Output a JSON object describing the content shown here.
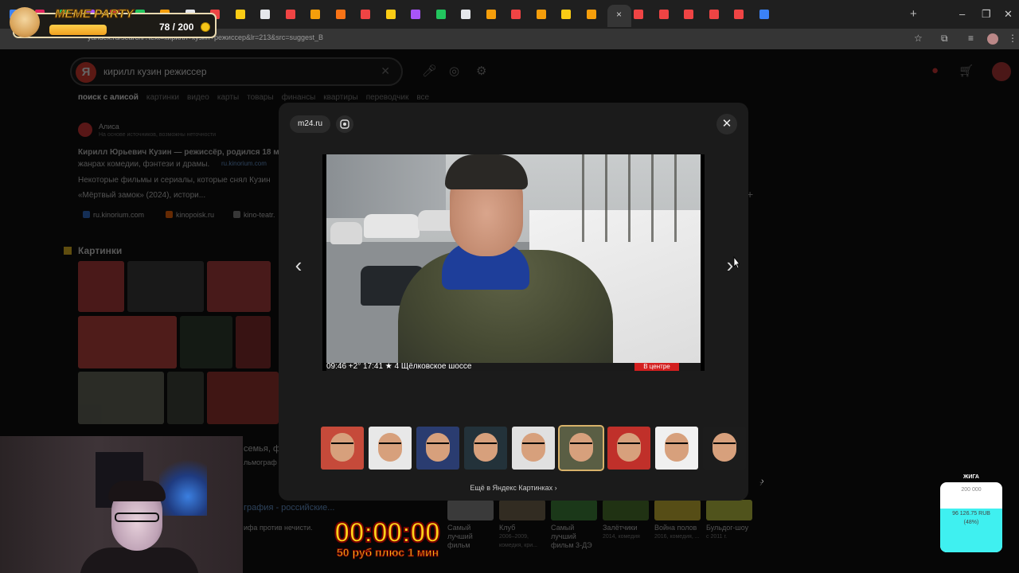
{
  "browser": {
    "active_tab_close": "×",
    "new_tab": "+",
    "window_controls": {
      "minimize": "–",
      "maximize": "❐",
      "close": "✕"
    },
    "url": "yandex.ru/search/?text=кирилл+кузин+режиссер&lr=213&src=suggest_B",
    "tab_favicon_colors": [
      "#3b82f6",
      "#e0245e",
      "#22c55e",
      "#a855f7",
      "#ef4444",
      "#22c55e",
      "#f59e0b",
      "#e5e7eb",
      "#ef4444",
      "#facc15",
      "#e5e7eb",
      "#ef4444",
      "#f59e0b",
      "#f97316",
      "#ef4444",
      "#facc15",
      "#a855f7",
      "#22c55e",
      "#e5e7eb",
      "#f59e0b",
      "#ef4444",
      "#f59e0b",
      "#facc15",
      "#f59e0b",
      "#ef4444",
      "#ef4444",
      "#ef4444",
      "#ef4444",
      "#ef4444",
      "#3b82f6"
    ]
  },
  "overlay_meme": {
    "title": "MEME PARTY",
    "count": "78 / 200"
  },
  "yandex": {
    "query": "кирилл кузин режиссер",
    "nav_tabs": [
      "поиск с алисой",
      "картинки",
      "видео",
      "карты",
      "товары",
      "финансы",
      "квартиры",
      "переводчик",
      "все"
    ],
    "alice_name": "Алиса",
    "alice_sub": "На основе источников, возможны неточности",
    "answer_line1": "Кирилл Юрьевич Кузин — режиссёр, родился 18 м",
    "answer_line2": "жанрах комедии, фэнтези и драмы.",
    "answer_source": "ru.kinorium.com",
    "answer_line3": "Некоторые фильмы и сериалы, которые снял Кузин",
    "answer_line4": "«Мёртвый замок» (2024), истори...",
    "sources": [
      "ru.kinorium.com",
      "kinopoisk.ru",
      "kino-teatr."
    ],
    "images_section": "Картинки",
    "bg_snippet_1": "семья, фи",
    "bg_snippet_2": "льмограф",
    "bg_snippet_3": "графия - российские...",
    "bg_snippet_4": "ифа против нечисти.",
    "films": [
      {
        "title": "Самый лучший фильм",
        "meta": ""
      },
      {
        "title": "Клуб",
        "meta": "2006–2009, комедия, кри..."
      },
      {
        "title": "Самый лучший фильм 3-ДЭ",
        "meta": ""
      },
      {
        "title": "Залётчики",
        "meta": "2014, комедия"
      },
      {
        "title": "Война полов",
        "meta": "2016, комедия, ..."
      },
      {
        "title": "Бульдог-шоу",
        "meta": "с 2011 г."
      }
    ]
  },
  "modal": {
    "source_chip": "m24.ru",
    "close_icon": "✕",
    "prev_icon": "‹",
    "next_icon": "›",
    "photo_ticker": "09:46  +2°  17:41  ★ 4  Щёлковское шоссе",
    "photo_live_badge": "В центре",
    "strip_next_icon": "›",
    "selected_index": 5,
    "more_link": "Ещё в Яндекс Картинках ›"
  },
  "timer": {
    "time": "00:00:00",
    "subtitle": "50 руб плюс 1 мин"
  },
  "donation": {
    "title": "ЖИГА",
    "goal": "200 000",
    "amount": "96 126.75 RUB",
    "percent": "(48%)",
    "progress": 0.48
  }
}
